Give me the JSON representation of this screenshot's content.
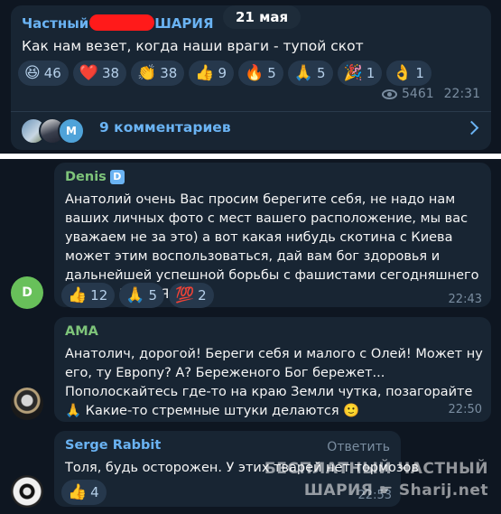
{
  "post": {
    "date": "21 мая",
    "channel_prefix": "Частный",
    "channel_suffix": "ШАРИЯ",
    "text": "Как нам везет, когда наши враги - тупой скот",
    "reactions": [
      {
        "emoji": "😆",
        "count": "46",
        "icon": "laughing-emoji-icon"
      },
      {
        "emoji": "❤️",
        "count": "38",
        "icon": "heart-emoji-icon"
      },
      {
        "emoji": "👏",
        "count": "38",
        "icon": "clap-emoji-icon"
      },
      {
        "emoji": "👍",
        "count": "9",
        "icon": "thumbs-up-emoji-icon"
      },
      {
        "emoji": "🔥",
        "count": "5",
        "icon": "fire-emoji-icon"
      },
      {
        "emoji": "🙏",
        "count": "5",
        "icon": "pray-emoji-icon"
      },
      {
        "emoji": "🎉",
        "count": "1",
        "icon": "party-emoji-icon"
      },
      {
        "emoji": "👌",
        "count": "1",
        "icon": "ok-hand-emoji-icon"
      }
    ],
    "views": "5461",
    "time": "22:31",
    "comments_label": "9 комментариев",
    "avatar_letter": "M"
  },
  "comments": [
    {
      "author": "Denis",
      "author_color": "#7ec47a",
      "verified_letter": "D",
      "avatar_letter": "D",
      "avatar_color": "#68c05a",
      "text": "Анатолий очень Вас просим берегите себя,  не надо нам ваших личных фото с мест вашего расположение,  мы вас уважаем не за это) а вот  какая нибудь скотина с Киева может этим воспользоваться,  дай вам бог здоровья и дальнейшей успешной борьбы с фашистами сегодняшнего дня. За ШАРИЯ!!!!",
      "reactions": [
        {
          "emoji": "👍",
          "count": "12",
          "icon": "thumbs-up-emoji-icon"
        },
        {
          "emoji": "🙏",
          "count": "5",
          "icon": "pray-emoji-icon"
        },
        {
          "emoji": "💯",
          "count": "2",
          "icon": "hundred-emoji-icon"
        }
      ],
      "time": "22:43"
    },
    {
      "author": "AMA",
      "author_color": "#7ec47a",
      "text": "Анатолич, дорогой! Береги себя и малого с Олей! Может ну его, ту Европу? А? Береженого Бог бережет... Пополоскайтесь где-то на краю Земли чутка, позагорайте 🙏 Какие-то стремные штуки делаются 🙂",
      "time": "22:50"
    },
    {
      "author": "Serge Rabbit",
      "author_color": "#6ab3f3",
      "reply_label": "Ответить",
      "text": "Толя, будь осторожен. У этих тварей нет тормозов",
      "reactions": [
        {
          "emoji": "👍",
          "count": "4",
          "icon": "thumbs-up-emoji-icon"
        }
      ],
      "time": "22:53"
    }
  ],
  "watermark": {
    "line1": "БЕСПЛАТНЫЙ ЧАСТНЫЙ",
    "line2": "ШАРИЯ ☛ Sharij.net"
  }
}
